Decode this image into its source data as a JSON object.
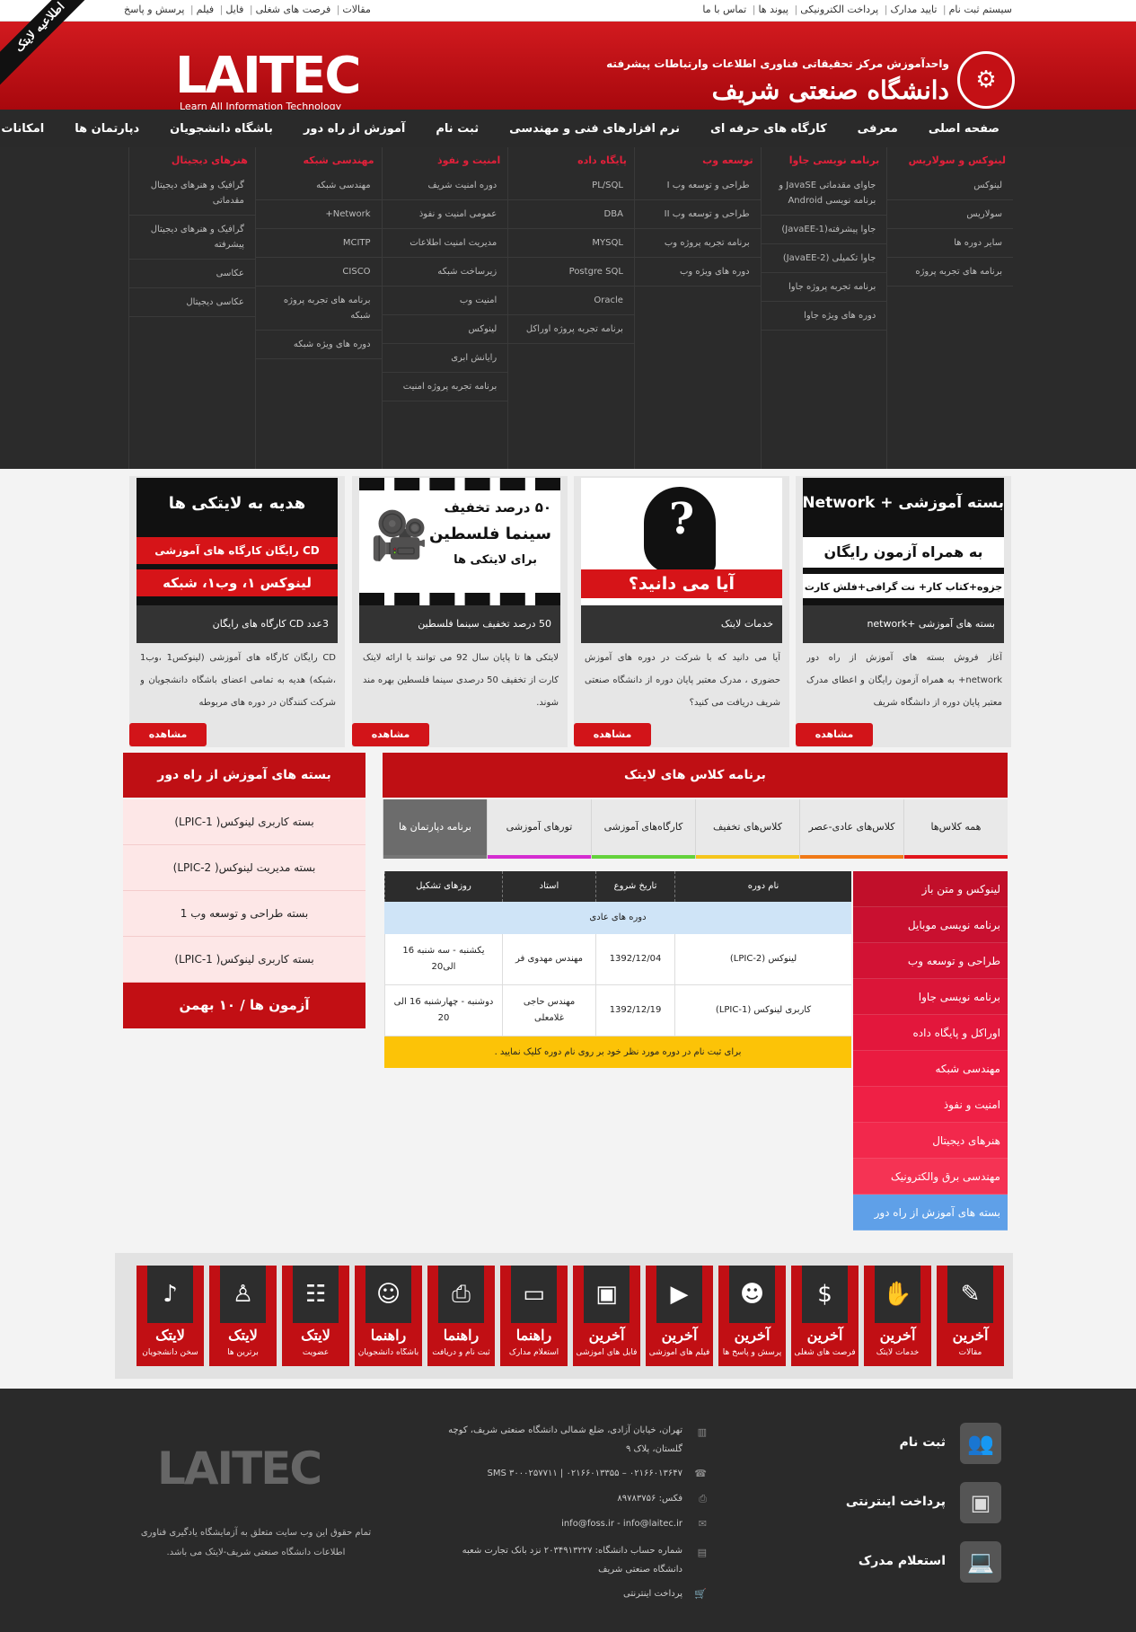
{
  "topbar": {
    "right_links": [
      "سیستم ثبت نام",
      "تایید مدارک",
      "پرداخت الکترونیکی",
      "پیوند ها",
      "تماس با ما"
    ],
    "left_links": [
      "مقالات",
      "فرصت های شغلی",
      "فایل",
      "فیلم",
      "پرسش و پاسخ"
    ]
  },
  "header": {
    "ribbon": "اطلاعیه لایتک",
    "logo": "LAITEC",
    "logo_tagline": "Learn All Information Technology",
    "uni_sub": "واحدآموزش مرکز تحقیقاتی فناوری اطلاعات وارتباطات پیشرفته",
    "uni_name": "دانشگاه صنعتی شریف"
  },
  "nav": [
    "صفحه اصلی",
    "معرفی",
    "کارگاه های حرفه ای",
    "نرم افزارهای فنی و مهندسی",
    "ثبت نام",
    "آموزش از راه دور",
    "باشگاه دانشجویان",
    "دپارتمان ها",
    "امکانات"
  ],
  "mega": [
    {
      "title": "لینوکس و سولاریس",
      "items": [
        "لینوکس",
        "سولاریس",
        "سایر دوره ها",
        "برنامه های تجربه پروژه"
      ]
    },
    {
      "title": "برنامه نویسی جاوا",
      "items": [
        "جاوای مقدماتی JavaSE و برنامه نویسی Android",
        "جاوا پیشرفته(JavaEE-1)",
        "جاوا تکمیلی (JavaEE-2)",
        "برنامه تجربه پروژه جاوا",
        "دوره های ویژه جاوا"
      ]
    },
    {
      "title": "توسعه وب",
      "items": [
        "طراحی و توسعه وب I",
        "طراحی و توسعه وب II",
        "برنامه تجربه پروژه وب",
        "دوره های ویژه وب"
      ]
    },
    {
      "title": "پایگاه داده",
      "items": [
        "PL/SQL",
        "DBA",
        "MYSQL",
        "Postgre SQL",
        "Oracle",
        "برنامه تجربه پروژه اوراکل"
      ]
    },
    {
      "title": "امنیت و نفوذ",
      "items": [
        "دوره امنیت شریف",
        "عمومی امنیت و نفوذ",
        "مدیریت امنیت اطلاعات",
        "زیرساخت شبکه",
        "امنیت وب",
        "لینوکس",
        "رایانش ابری",
        "برنامه تجربه پروژه امنیت"
      ]
    },
    {
      "title": "مهندسی شبکه",
      "items": [
        "مهندسی شبکه",
        "Network+",
        "MCITP",
        "CISCO",
        "برنامه های تجربه پروژه شبکه",
        "دوره های ویژه شبکه"
      ]
    },
    {
      "title": "هنرهای دیجیتال",
      "items": [
        "گرافیک و هنرهای دیجیتال مقدماتی",
        "گرافیک و هنرهای دیجیتال پیشرفته",
        "عکاسی",
        "عکاسی دیجیتال"
      ]
    }
  ],
  "cards": [
    {
      "img_title": "بسته آموزشی",
      "img_title2": "+ Network",
      "img_band": "به همراه آزمون رایگان",
      "img_sub": "جزوه+کتاب کار+ نت گرافی+فلش کارت",
      "caption": "بسته های آموزشی +network",
      "text": "آغاز فروش بسته های آموزش از راه دور network+ به همراه آزمون رایگان و اعطای مدرک معتبر پایان دوره از دانشگاه شریف",
      "button": "مشاهده"
    },
    {
      "img_title": "?",
      "img_band": "آیا می دانید؟",
      "caption": "خدمات لایتک",
      "text": "آیا می دانید که با شرکت در دوره های آموزش حضوری ، مدرک معتبر پایان دوره از دانشگاه صنعتی شریف دریافت می کنید؟",
      "button": "مشاهده"
    },
    {
      "img_title": "۵۰ درصد تخفیف",
      "img_title2": "سینما فلسطین",
      "img_sub": "برای لایتکی ها",
      "caption": "50 درصد تخفیف سینما فلسطین",
      "text": "لایتکی ها تا پایان سال 92 می توانند با ارائه لایتک کارت از تخفیف 50 درصدی سینما فلسطین بهره مند شوند.",
      "button": "مشاهده"
    },
    {
      "img_title": "هدیه به لایتکی ها",
      "img_band": "CD رایگان کارگاه های آموزشی",
      "img_band2": "لینوکس ۱، وب۱، شبکه",
      "caption": "3عدد CD کارگاه های رایگان",
      "text": "CD رایگان کارگاه های آموزشی (لینوکس1 ،وب1 ،شبکه) هدیه به تمامی اعضای باشگاه دانشجویان و شرکت کنندگان در دوره های مربوطه",
      "button": "مشاهده"
    }
  ],
  "distance": {
    "title": "بسته های آموزش از راه دور",
    "items": [
      "بسته کاربری لینوکس( LPIC-1)",
      "بسته مدیریت لینوکس( LPIC-2)",
      "بسته طراحی و توسعه وب 1",
      "بسته کاربری لینوکس( LPIC-1)"
    ],
    "footer": "آزمون ها / ۱۰ بهمن"
  },
  "classes": {
    "title": "برنامه کلاس های لایتک",
    "tabs": [
      {
        "label": "همه کلاس‌ها",
        "color": "#e2151b"
      },
      {
        "label": "کلاس‌های عادی-عصر",
        "color": "#f07a17"
      },
      {
        "label": "کلاس‌های تخفیف",
        "color": "#f5c51b"
      },
      {
        "label": "کارگاه‌های آموزشی",
        "color": "#64d23c"
      },
      {
        "label": "تورهای آموزشی",
        "color": "#d42dd0"
      },
      {
        "label": "برنامه دپارتمان ها",
        "color": "#777777"
      }
    ],
    "headers": [
      "نام دوره",
      "تاریخ شروع",
      "استاد",
      "روزهای تشکیل"
    ],
    "group": "دوره های عادی",
    "rows": [
      {
        "name": "لینوکس (LPIC-2)",
        "date": "1392/12/04",
        "teacher": "مهندس مهدوی فر",
        "days": "یکشنبه - سه شنبه 16 الی20"
      },
      {
        "name": "کاربری لینوکس (LPIC-1)",
        "date": "1392/12/19",
        "teacher": "مهندس حاجی غلامعلی",
        "days": "دوشنبه - چهارشنبه 16 الی 20"
      }
    ],
    "note": "برای ثبت نام در دوره مورد نظر خود بر روی نام دوره کلیک نمایید .",
    "categories": [
      "لینوکس و متن باز",
      "برنامه نویسی موبایل",
      "طراحی و توسعه وب",
      "برنامه نویسی جاوا",
      "اوراکل و پایگاه داده",
      "مهندسی شبکه",
      "امنیت و نفوذ",
      "هنرهای دیجیتال",
      "مهندسی برق والکترونیک",
      "بسته های آموزش از راه دور"
    ]
  },
  "tiles": [
    {
      "title": "آخرین",
      "sub": "مقالات",
      "icon": "✎"
    },
    {
      "title": "آخرین",
      "sub": "خدمات لایتک",
      "icon": "✋"
    },
    {
      "title": "آخرین",
      "sub": "فرصت های شغلی",
      "icon": "$"
    },
    {
      "title": "آخرین",
      "sub": "پرسش و پاسخ ها",
      "icon": "☻"
    },
    {
      "title": "آخرین",
      "sub": "فیلم های آموزشی",
      "icon": "▶"
    },
    {
      "title": "آخرین",
      "sub": "فایل های آموزشی",
      "icon": "▣"
    },
    {
      "title": "راهنما",
      "sub": "استعلام مدارک",
      "icon": "▭"
    },
    {
      "title": "راهنما",
      "sub": "ثبت نام و دریافت",
      "icon": "⎙"
    },
    {
      "title": "راهنما",
      "sub": "باشگاه دانشجویان",
      "icon": "☺"
    },
    {
      "title": "لایتک",
      "sub": "عضویت",
      "icon": "☷"
    },
    {
      "title": "لایتک",
      "sub": "برترین ها",
      "icon": "♙"
    },
    {
      "title": "لایتک",
      "sub": "سخن دانشجویان",
      "icon": "♪"
    }
  ],
  "footer": {
    "actions": [
      "ثبت نام",
      "پرداخت اینترنتی",
      "استعلام مدرک"
    ],
    "address": "تهران، خیابان آزادی، ضلع شمالی دانشگاه صنعتی شریف، کوچه گلستان، پلاک ۹",
    "phone": "۰۲۱۶۶۰۱۳۶۴۷ – ۰۲۱۶۶۰۱۳۳۵۵ | SMS ۳۰۰۰۲۵۷۷۱۱",
    "fax": "فکس: ۸۹۷۸۳۷۵۶",
    "email": "info@foss.ir - info@laitec.ir",
    "account": "شماره حساب دانشگاه: ۲۰۳۴۹۱۳۲۲۷ نزد بانک تجارت شعبه دانشگاه صنعتی شریف",
    "pay": "پرداخت اینترنتی",
    "logo": "LAITEC",
    "copyright": "تمام حقوق این وب سایت متعلق به آزمایشگاه یادگیری فناوری اطلاعات دانشگاه صنعتی شریف-لایتک می باشد."
  }
}
